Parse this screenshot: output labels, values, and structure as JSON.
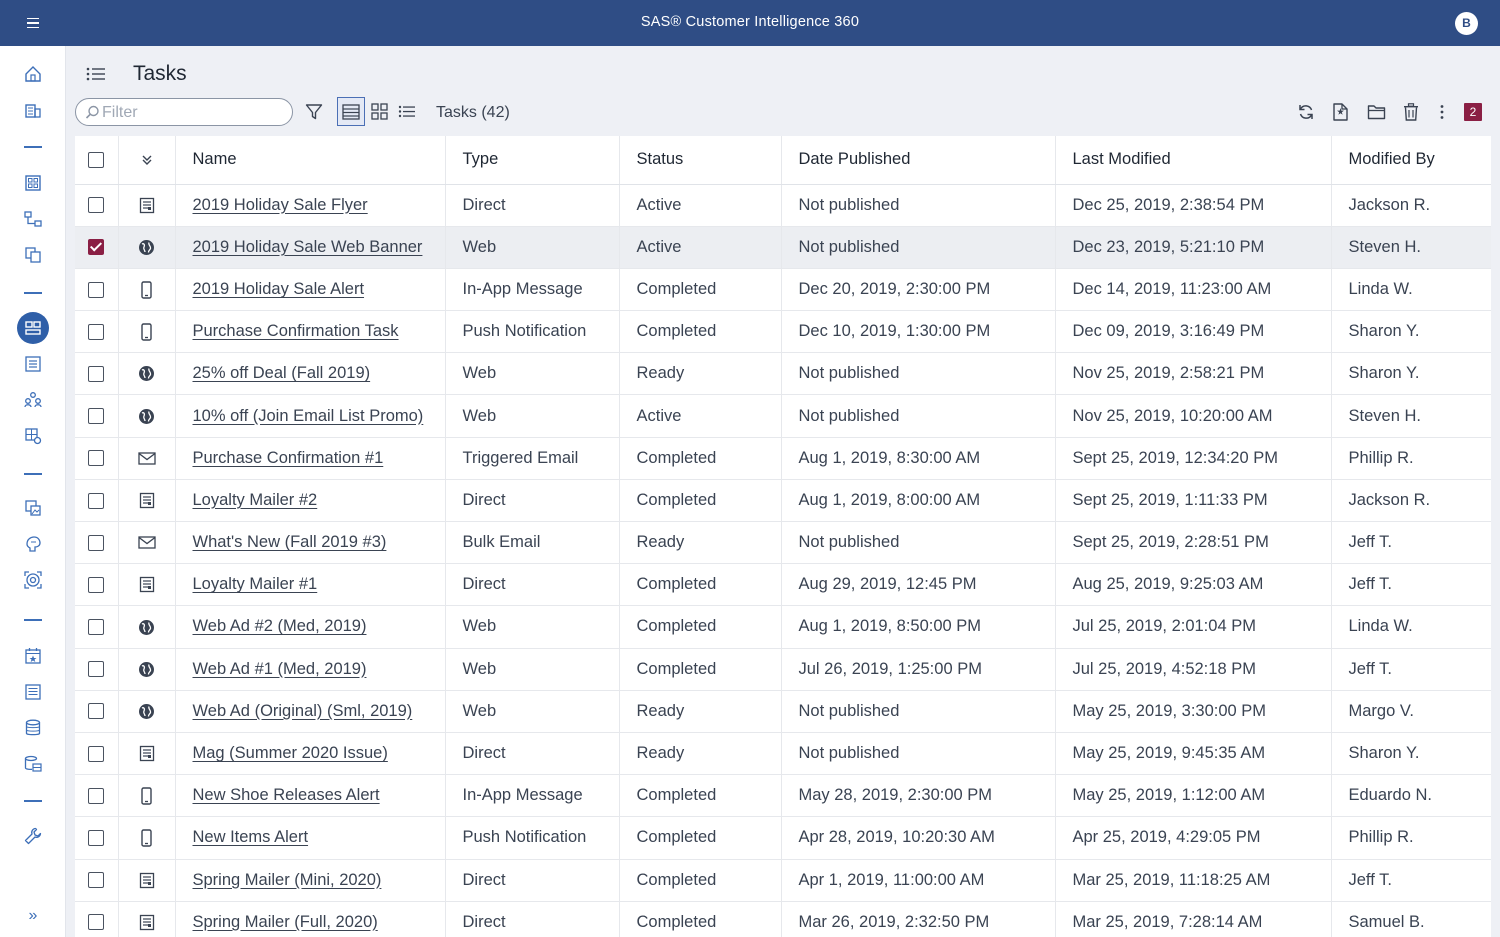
{
  "app": {
    "title": "SAS® Customer Intelligence 360",
    "user_initial": "B"
  },
  "page": {
    "title": "Tasks"
  },
  "toolbar": {
    "filter_placeholder": "Filter",
    "count_label": "Tasks (42)",
    "notification_count": "2"
  },
  "table": {
    "columns": [
      "Name",
      "Type",
      "Status",
      "Date Published",
      "Last Modified",
      "Modified By"
    ],
    "rows": [
      {
        "icon": "document-icon",
        "checked": false,
        "name": "2019 Holiday Sale Flyer",
        "type": "Direct",
        "status": "Active",
        "published": "Not published",
        "modified": "Dec 25, 2019, 2:38:54 PM",
        "by": "Jackson R."
      },
      {
        "icon": "globe-icon",
        "checked": true,
        "name": "2019 Holiday Sale Web Banner",
        "type": "Web",
        "status": "Active",
        "published": "Not published",
        "modified": "Dec 23, 2019, 5:21:10 PM",
        "by": "Steven H."
      },
      {
        "icon": "mobile-icon",
        "checked": false,
        "name": "2019 Holiday Sale Alert",
        "type": "In-App Message",
        "status": "Completed",
        "published": "Dec 20, 2019, 2:30:00 PM",
        "modified": "Dec 14, 2019, 11:23:00 AM",
        "by": "Linda W."
      },
      {
        "icon": "mobile-icon",
        "checked": false,
        "name": "Purchase Confirmation Task",
        "type": "Push Notification",
        "status": "Completed",
        "published": "Dec 10, 2019, 1:30:00 PM",
        "modified": "Dec 09, 2019, 3:16:49 PM",
        "by": "Sharon Y."
      },
      {
        "icon": "globe-icon",
        "checked": false,
        "name": "25% off Deal (Fall 2019)",
        "type": "Web",
        "status": "Ready",
        "published": "Not published",
        "modified": "Nov 25, 2019, 2:58:21 PM",
        "by": "Sharon Y."
      },
      {
        "icon": "globe-icon",
        "checked": false,
        "name": "10% off (Join Email List Promo)",
        "type": "Web",
        "status": "Active",
        "published": "Not published",
        "modified": "Nov 25, 2019, 10:20:00 AM",
        "by": "Steven H."
      },
      {
        "icon": "envelope-icon",
        "checked": false,
        "name": "Purchase Confirmation #1",
        "type": "Triggered Email",
        "status": "Completed",
        "published": "Aug 1, 2019, 8:30:00 AM",
        "modified": "Sept 25, 2019, 12:34:20 PM",
        "by": "Phillip R."
      },
      {
        "icon": "document-icon",
        "checked": false,
        "name": "Loyalty Mailer #2",
        "type": "Direct",
        "status": "Completed",
        "published": "Aug 1, 2019, 8:00:00 AM",
        "modified": "Sept 25, 2019, 1:11:33 PM",
        "by": "Jackson R."
      },
      {
        "icon": "envelope-icon",
        "checked": false,
        "name": "What's New (Fall 2019 #3)",
        "type": "Bulk Email",
        "status": "Ready",
        "published": "Not published",
        "modified": "Sept 25, 2019, 2:28:51 PM",
        "by": "Jeff T."
      },
      {
        "icon": "document-icon",
        "checked": false,
        "name": "Loyalty Mailer #1",
        "type": "Direct",
        "status": "Completed",
        "published": "Aug 29, 2019, 12:45 PM",
        "modified": "Aug 25, 2019, 9:25:03 AM",
        "by": "Jeff T."
      },
      {
        "icon": "globe-icon",
        "checked": false,
        "name": "Web Ad #2 (Med, 2019)",
        "type": "Web",
        "status": "Completed",
        "published": "Aug 1, 2019, 8:50:00 PM",
        "modified": "Jul 25, 2019, 2:01:04 PM",
        "by": "Linda W."
      },
      {
        "icon": "globe-icon",
        "checked": false,
        "name": "Web Ad #1 (Med, 2019)",
        "type": "Web",
        "status": "Completed",
        "published": "Jul 26, 2019, 1:25:00 PM",
        "modified": "Jul 25, 2019, 4:52:18 PM",
        "by": "Jeff T."
      },
      {
        "icon": "globe-icon",
        "checked": false,
        "name": "Web Ad (Original) (Sml, 2019)",
        "type": "Web",
        "status": "Ready",
        "published": "Not published",
        "modified": "May 25, 2019, 3:30:00 PM",
        "by": "Margo V."
      },
      {
        "icon": "document-icon",
        "checked": false,
        "name": "Mag (Summer 2020 Issue)",
        "type": "Direct",
        "status": "Ready",
        "published": "Not published",
        "modified": "May 25, 2019, 9:45:35 AM",
        "by": "Sharon Y."
      },
      {
        "icon": "mobile-icon",
        "checked": false,
        "name": "New Shoe Releases Alert",
        "type": "In-App Message",
        "status": "Completed",
        "published": "May 28, 2019, 2:30:00 PM",
        "modified": "May 25, 2019, 1:12:00 AM",
        "by": "Eduardo N."
      },
      {
        "icon": "mobile-icon",
        "checked": false,
        "name": "New Items Alert",
        "type": "Push Notification",
        "status": "Completed",
        "published": "Apr 28, 2019, 10:20:30 AM",
        "modified": "Apr 25, 2019, 4:29:05 PM",
        "by": "Phillip R."
      },
      {
        "icon": "document-icon",
        "checked": false,
        "name": "Spring Mailer (Mini, 2020)",
        "type": "Direct",
        "status": "Completed",
        "published": "Apr 1, 2019, 11:00:00 AM",
        "modified": "Mar 25, 2019, 11:18:25 AM",
        "by": "Jeff T."
      },
      {
        "icon": "document-icon",
        "checked": false,
        "name": "Spring Mailer (Full, 2020)",
        "type": "Direct",
        "status": "Completed",
        "published": "Mar 26, 2019, 2:32:50 PM",
        "modified": "Mar 25, 2019, 7:28:14 AM",
        "by": "Samuel B."
      }
    ]
  },
  "sidebar": {
    "items": [
      {
        "icon": "home-icon"
      },
      {
        "icon": "building-icon"
      },
      {
        "icon": "dashboard-icon"
      },
      {
        "icon": "flow-icon"
      },
      {
        "icon": "copy-icon"
      },
      {
        "icon": "tasks-icon",
        "active": true
      },
      {
        "icon": "list-icon"
      },
      {
        "icon": "users-icon"
      },
      {
        "icon": "grid-gear-icon"
      },
      {
        "icon": "image-icon"
      },
      {
        "icon": "brain-icon"
      },
      {
        "icon": "target-icon"
      },
      {
        "icon": "calendar-icon"
      },
      {
        "icon": "report-icon"
      },
      {
        "icon": "database-icon"
      },
      {
        "icon": "data-table-icon"
      },
      {
        "icon": "wrench-icon"
      }
    ]
  }
}
